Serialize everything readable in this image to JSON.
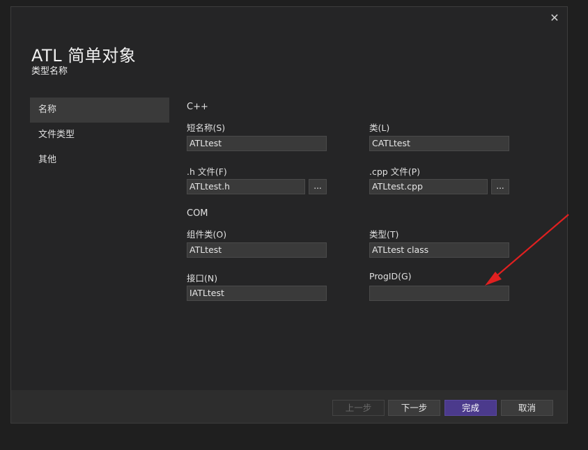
{
  "dialog": {
    "title": "ATL 简单对象",
    "subtitle": "类型名称",
    "close_glyph": "✕"
  },
  "nav": {
    "items": [
      {
        "label": "名称",
        "active": true
      },
      {
        "label": "文件类型"
      },
      {
        "label": "其他"
      }
    ]
  },
  "cpp": {
    "section": "C++",
    "short_name_label": "短名称(S)",
    "short_name_value": "ATLtest",
    "class_label": "类(L)",
    "class_value": "CATLtest",
    "h_file_label": ".h 文件(F)",
    "h_file_value": "ATLtest.h",
    "cpp_file_label": ".cpp 文件(P)",
    "cpp_file_value": "ATLtest.cpp",
    "browse_label": "..."
  },
  "com": {
    "section": "COM",
    "coclass_label": "组件类(O)",
    "coclass_value": "ATLtest",
    "type_label": "类型(T)",
    "type_value": "ATLtest class",
    "interface_label": "接口(N)",
    "interface_value": "IATLtest",
    "progid_label": "ProgID(G)",
    "progid_value": ""
  },
  "footer": {
    "prev_label": "上一步",
    "next_label": "下一步",
    "finish_label": "完成",
    "cancel_label": "取消"
  },
  "colors": {
    "background": "#252526",
    "input": "#3a3a3a",
    "primary_button": "#4b3a8c",
    "annotation_arrow": "#e02020"
  }
}
